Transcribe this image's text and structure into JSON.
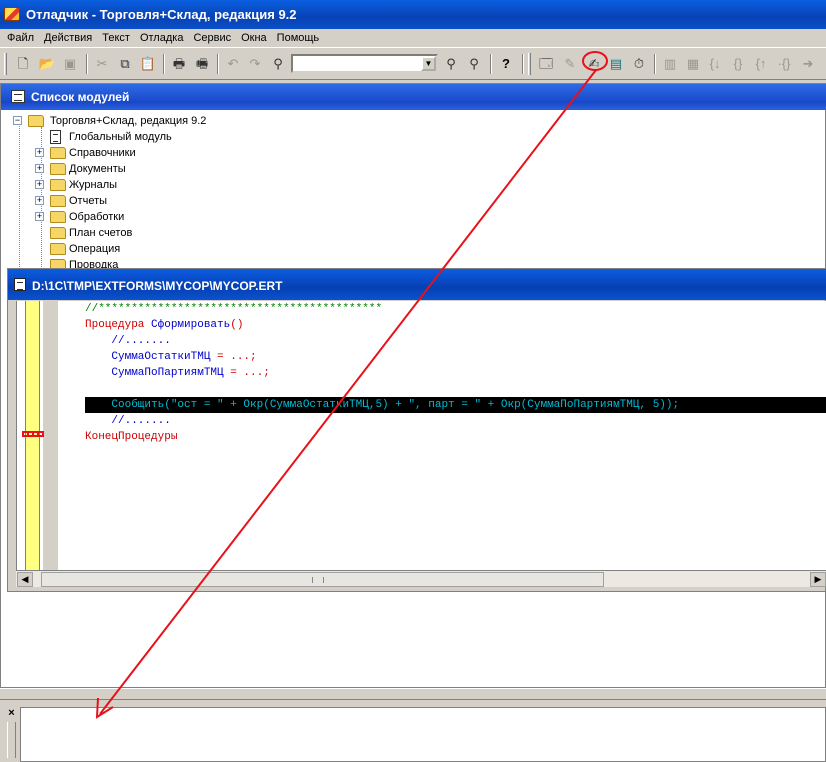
{
  "window": {
    "title": "Отладчик - Торговля+Склад, редакция 9.2"
  },
  "menu": [
    "Файл",
    "Действия",
    "Текст",
    "Отладка",
    "Сервис",
    "Окна",
    "Помощь"
  ],
  "toolbar": {
    "left_icons": [
      "new-doc-icon",
      "open-folder-icon",
      "save-icon",
      "cut-icon",
      "copy-icon",
      "paste-icon",
      "print-icon",
      "print-preview-icon",
      "undo-icon",
      "redo-icon",
      "find-icon"
    ],
    "search_value": "",
    "right_icons": [
      "find-next-icon",
      "find-prev-icon",
      "help-icon",
      "debug-window-icon",
      "breakpoint-icon",
      "watch-icon",
      "call-stack-icon",
      "timer-icon",
      "step-icon",
      "step-into-icon",
      "step-over-icon",
      "step-out-icon",
      "run-to-cursor-icon",
      "continue-icon",
      "go-icon"
    ]
  },
  "module_list": {
    "header": "Список модулей",
    "root": "Торговля+Склад, редакция 9.2",
    "items": [
      {
        "label": "Глобальный модуль",
        "type": "doc",
        "expandable": false
      },
      {
        "label": "Справочники",
        "type": "folder",
        "expandable": true
      },
      {
        "label": "Документы",
        "type": "folder",
        "expandable": true
      },
      {
        "label": "Журналы",
        "type": "folder",
        "expandable": true
      },
      {
        "label": "Отчеты",
        "type": "folder",
        "expandable": true
      },
      {
        "label": "Обработки",
        "type": "folder",
        "expandable": true
      },
      {
        "label": "План счетов",
        "type": "folder",
        "expandable": false
      },
      {
        "label": "Операция",
        "type": "folder",
        "expandable": false
      },
      {
        "label": "Проводка",
        "type": "folder",
        "expandable": false
      }
    ]
  },
  "editor": {
    "title": "D:\\1C\\TMP\\EXTFORMS\\MYCOP\\MYCOP.ERT",
    "lines": {
      "l1": "//*******************************************",
      "l2_kw": "Процедура ",
      "l2_name": "Сформировать",
      "l2_paren": "()",
      "l3": "    //.......",
      "l4_var": "    СуммаОстаткиТМЦ",
      "l4_op": " = ...;",
      "l5_var": "    СуммаПоПартиямТМЦ",
      "l5_op": " = ...;",
      "l6": "",
      "l7": "    Сообщить(\"ост = \" + Окр(СуммаОстаткиТМЦ,5) + \", парт = \" + Окр(СуммаПоПартиямТМЦ, 5));",
      "l8": "    //.......",
      "l9": "КонецПроцедуры"
    }
  },
  "colors": {
    "title_blue": "#0842b5",
    "annotation_red": "#e8111a",
    "code_keyword": "#cc0000",
    "code_identifier": "#0000cc",
    "code_comment": "#008000"
  }
}
